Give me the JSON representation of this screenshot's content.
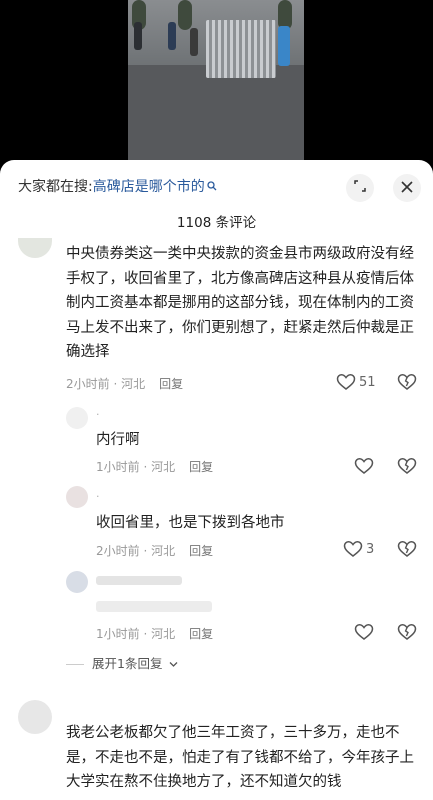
{
  "search": {
    "prefix": "大家都在搜:",
    "keyword": "高碑店是哪个市的"
  },
  "header": {
    "comment_count": "1108 条评论"
  },
  "comments": [
    {
      "text": "中央债券类这一类中央拨款的资金县市两级政府没有经手权了，收回省里了，北方像高碑店这种县从疫情后体制内工资基本都是挪用的这部分钱，现在体制内的工资马上发不出来了，你们更别想了，赶紧走然后仲裁是正确选择",
      "time": "2小时前 · 河北",
      "reply": "回复",
      "likes": "51",
      "replies": [
        {
          "name": "·",
          "text": "内行啊",
          "time": "1小时前 · 河北",
          "reply": "回复",
          "likes": ""
        },
        {
          "name": "·",
          "text": "收回省里，也是下拨到各地市",
          "time": "2小时前 · 河北",
          "reply": "回复",
          "likes": "3"
        },
        {
          "name": "",
          "text": "",
          "time": "1小时前 · 河北",
          "reply": "回复",
          "likes": ""
        }
      ],
      "expand_label": "展开1条回复"
    },
    {
      "text": "我老公老板都欠了他三年工资了，三十多万，走也不是，不走也不是，怕走了有了钱都不给了，今年孩子上大学实在熬不住换地方了，还不知道欠的钱"
    }
  ]
}
